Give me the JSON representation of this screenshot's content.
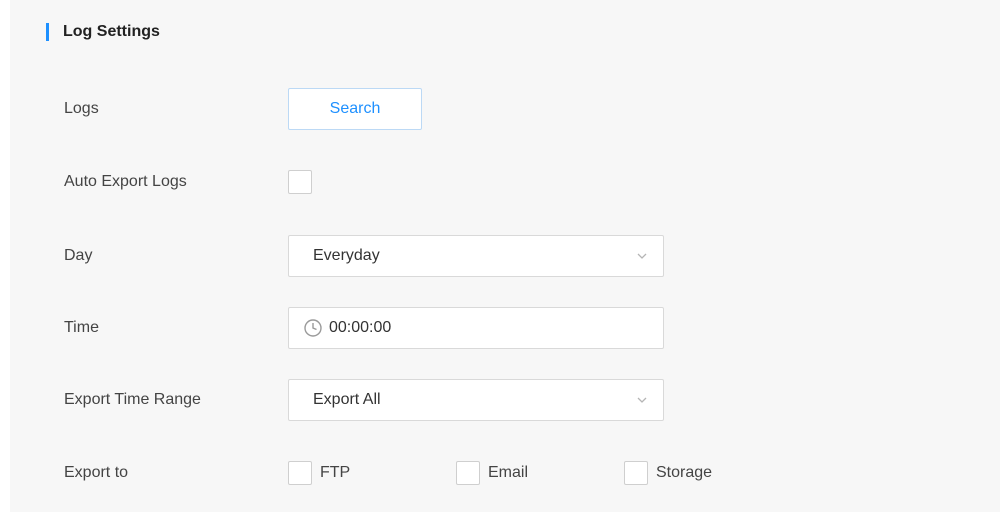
{
  "section": {
    "title": "Log Settings",
    "accent_color": "#1e90ff"
  },
  "logs": {
    "label": "Logs",
    "button_label": "Search"
  },
  "auto_export": {
    "label": "Auto Export Logs",
    "checked": false
  },
  "day": {
    "label": "Day",
    "value": "Everyday",
    "icon": "chevron-down-icon"
  },
  "time": {
    "label": "Time",
    "value": "00:00:00",
    "icon": "clock-icon"
  },
  "export_range": {
    "label": "Export Time Range",
    "value": "Export All",
    "icon": "chevron-down-icon"
  },
  "export_to": {
    "label": "Export to",
    "options": [
      {
        "label": "FTP",
        "checked": false
      },
      {
        "label": "Email",
        "checked": false
      },
      {
        "label": "Storage",
        "checked": false
      }
    ]
  }
}
